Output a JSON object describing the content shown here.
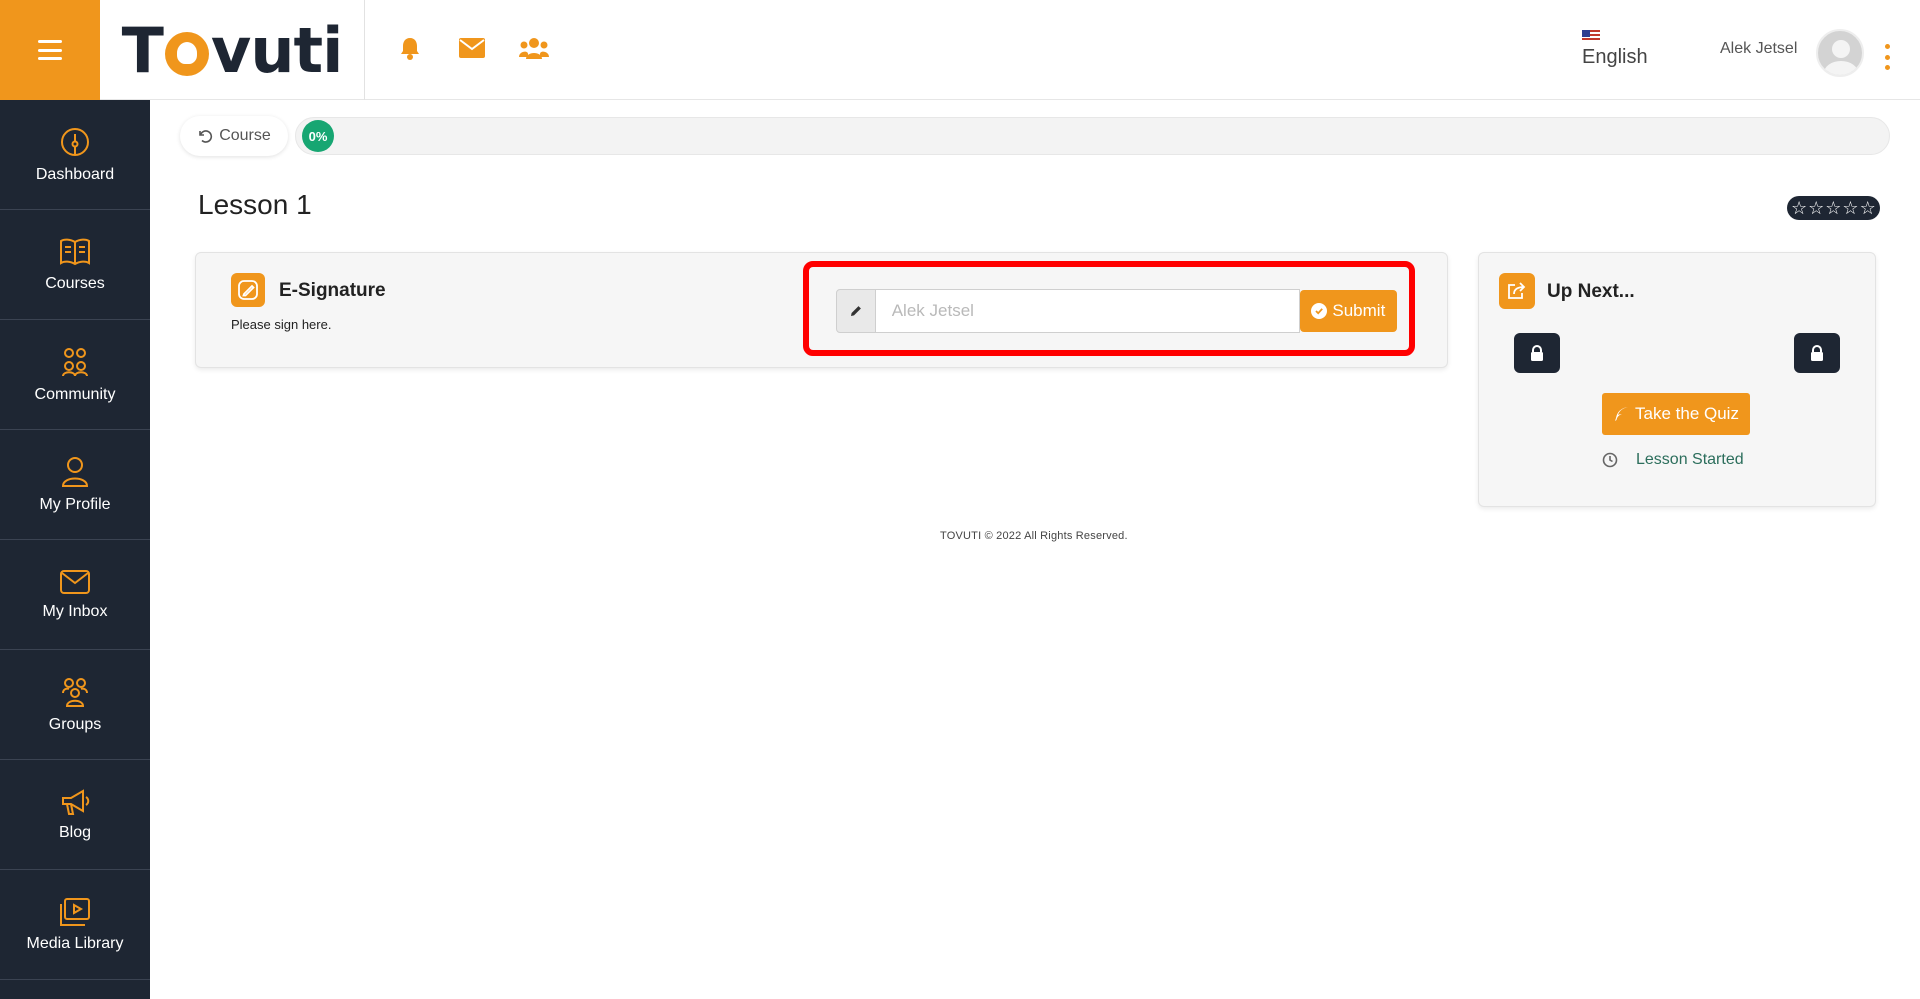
{
  "header": {
    "menu_icon": "hamburger-icon",
    "logo_text_before": "T",
    "logo_text_after": "vuti",
    "icons": [
      "bell-icon",
      "envelope-icon",
      "users-icon"
    ],
    "language": "English",
    "user_name": "Alek Jetsel"
  },
  "sidebar": {
    "items": [
      {
        "label": "Dashboard",
        "icon": "dashboard-icon"
      },
      {
        "label": "Courses",
        "icon": "book-icon"
      },
      {
        "label": "Community",
        "icon": "community-icon"
      },
      {
        "label": "My Profile",
        "icon": "profile-icon"
      },
      {
        "label": "My Inbox",
        "icon": "inbox-icon"
      },
      {
        "label": "Groups",
        "icon": "groups-icon"
      },
      {
        "label": "Blog",
        "icon": "megaphone-icon"
      },
      {
        "label": "Media Library",
        "icon": "media-library-icon"
      }
    ]
  },
  "breadcrumb": {
    "course_label": "Course",
    "progress_percent": "0%",
    "progress_value": 0
  },
  "lesson": {
    "title": "Lesson 1",
    "rating_stars": 5
  },
  "esignature": {
    "title": "E-Signature",
    "description": "Please sign here.",
    "input_placeholder": "Alek Jetsel",
    "input_value": "",
    "submit_label": "Submit"
  },
  "up_next": {
    "title": "Up Next...",
    "quiz_button": "Take the Quiz",
    "status": "Lesson Started"
  },
  "footer": {
    "text": "TOVUTI © 2022 All Rights Reserved."
  },
  "colors": {
    "accent": "#f0961c",
    "sidebar_bg": "#1e2633",
    "progress_green": "#17a672",
    "highlight_red": "#ff0000"
  }
}
